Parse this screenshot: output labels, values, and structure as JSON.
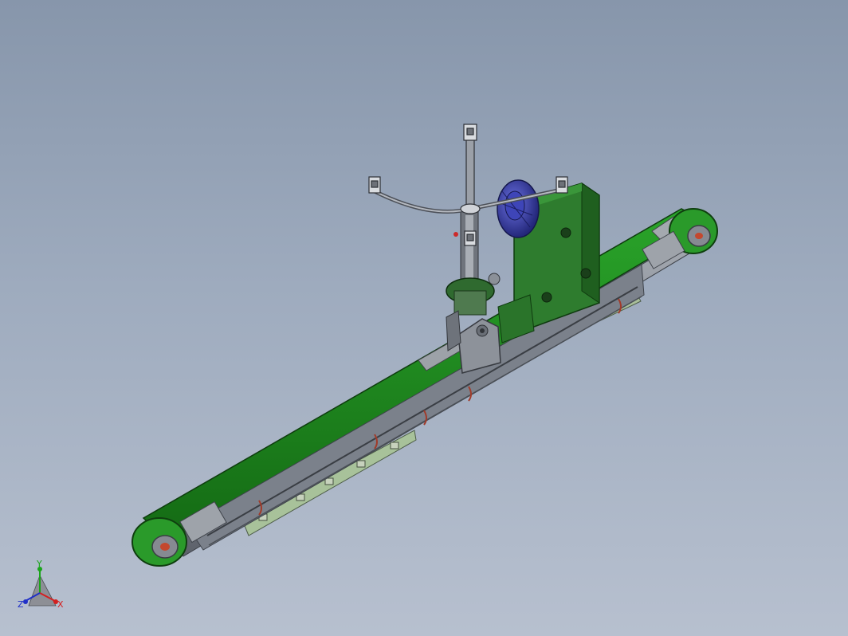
{
  "viewport": {
    "background_top": "#8796ab",
    "background_bottom": "#b7c0cf"
  },
  "model": {
    "belt_color": "#1f8a1f",
    "belt_edge_color": "#123d12",
    "frame_color": "#8a8f99",
    "motor_color": "#3a3fa8",
    "housing_color": "#2f7a2f"
  },
  "triad": {
    "y_label": "Y",
    "x_label": "X",
    "z_label": "Z",
    "y_color": "#1aa51a",
    "x_color": "#d42020",
    "z_color": "#2030c8"
  }
}
